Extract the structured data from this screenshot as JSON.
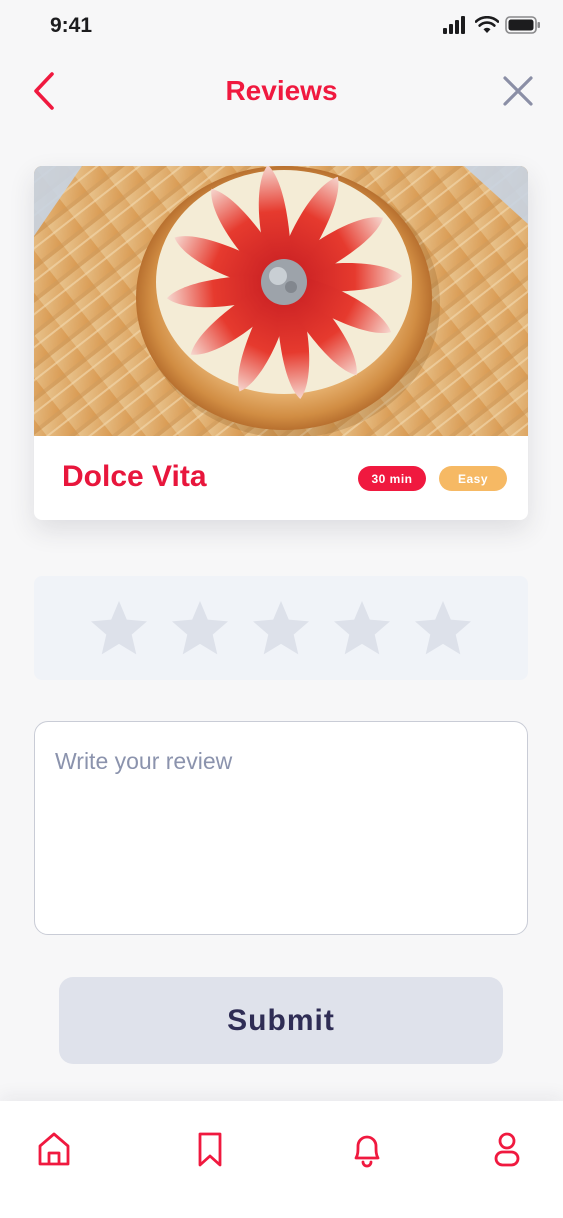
{
  "status_bar": {
    "time": "9:41"
  },
  "header": {
    "title": "Reviews",
    "back_icon": "chevron-left-icon",
    "close_icon": "close-icon"
  },
  "recipe": {
    "name": "Dolce Vita",
    "time_badge": "30 min",
    "difficulty_badge": "Easy"
  },
  "rating": {
    "max": 5,
    "value": 0
  },
  "review": {
    "placeholder": "Write your review",
    "value": ""
  },
  "submit": {
    "label": "Submit"
  },
  "tabs": [
    {
      "name": "home",
      "icon": "home-icon"
    },
    {
      "name": "saved",
      "icon": "bookmark-icon"
    },
    {
      "name": "notifications",
      "icon": "bell-icon"
    },
    {
      "name": "profile",
      "icon": "user-icon"
    }
  ],
  "colors": {
    "accent": "#f0193f",
    "badge_easy": "#f6b964",
    "star_empty": "#dde1ea",
    "button_bg": "#dfe2eb",
    "button_text": "#2f2d55"
  }
}
